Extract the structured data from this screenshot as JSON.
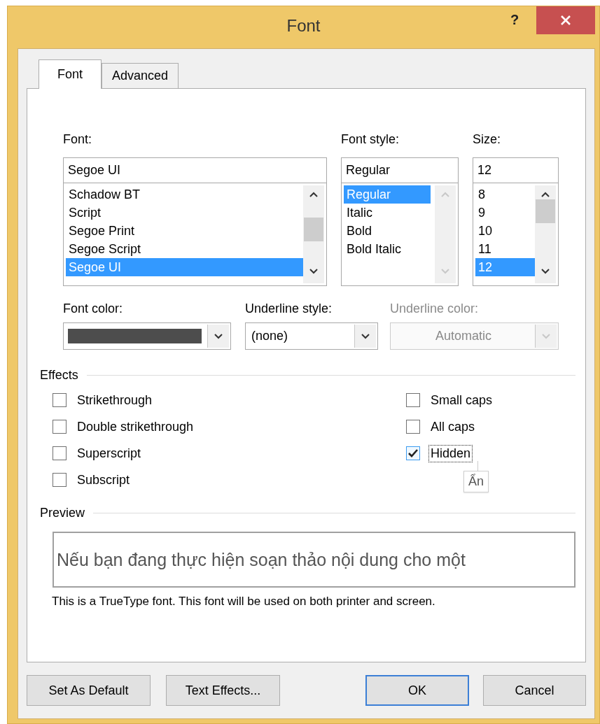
{
  "window": {
    "title": "Font",
    "help": "?"
  },
  "tabs": [
    {
      "label": "Font",
      "selected": true
    },
    {
      "label": "Advanced",
      "selected": false
    }
  ],
  "font": {
    "label": "Font:",
    "value": "Segoe UI",
    "scrollbar_disabled": false,
    "items": [
      {
        "label": "Schadow BT",
        "selected": false
      },
      {
        "label": "Script",
        "selected": false
      },
      {
        "label": "Segoe Print",
        "selected": false
      },
      {
        "label": "Segoe Script",
        "selected": false
      },
      {
        "label": "Segoe UI",
        "selected": true
      }
    ]
  },
  "font_style": {
    "label": "Font style:",
    "value": "Regular",
    "scrollbar_disabled": true,
    "items": [
      {
        "label": "Regular",
        "selected": true
      },
      {
        "label": "Italic",
        "selected": false
      },
      {
        "label": "Bold",
        "selected": false
      },
      {
        "label": "Bold Italic",
        "selected": false
      }
    ]
  },
  "size": {
    "label": "Size:",
    "value": "12",
    "scrollbar_disabled": false,
    "items": [
      {
        "label": "8",
        "selected": false
      },
      {
        "label": "9",
        "selected": false
      },
      {
        "label": "10",
        "selected": false
      },
      {
        "label": "11",
        "selected": false
      },
      {
        "label": "12",
        "selected": true
      }
    ]
  },
  "font_color": {
    "label": "Font color:",
    "color": "#4d4d4d",
    "disabled": false
  },
  "underline_style": {
    "label": "Underline style:",
    "value": "(none)",
    "disabled": false
  },
  "underline_color": {
    "label": "Underline color:",
    "value": "Automatic",
    "disabled": true
  },
  "effects": {
    "title": "Effects",
    "column_1": [
      {
        "label": "Strikethrough",
        "checked": false,
        "focused": false
      },
      {
        "label": "Double strikethrough",
        "checked": false,
        "focused": false
      },
      {
        "label": "Superscript",
        "checked": false,
        "focused": false
      },
      {
        "label": "Subscript",
        "checked": false,
        "focused": false
      }
    ],
    "column_2": [
      {
        "label": "Small caps",
        "checked": false,
        "focused": false
      },
      {
        "label": "All caps",
        "checked": false,
        "focused": false
      },
      {
        "label": "Hidden",
        "checked": true,
        "focused": true,
        "tooltip": "Ẩn"
      }
    ]
  },
  "preview": {
    "title": "Preview",
    "sample": "Nếu bạn đang thực hiện soạn thảo nội dung cho một",
    "note": "This is a TrueType font. This font will be used on both printer and screen."
  },
  "buttons": [
    {
      "label": "Set As Default",
      "default": false
    },
    {
      "label": "Text Effects...",
      "default": false
    },
    {
      "label": "OK",
      "default": true
    },
    {
      "label": "Cancel",
      "default": false
    }
  ]
}
